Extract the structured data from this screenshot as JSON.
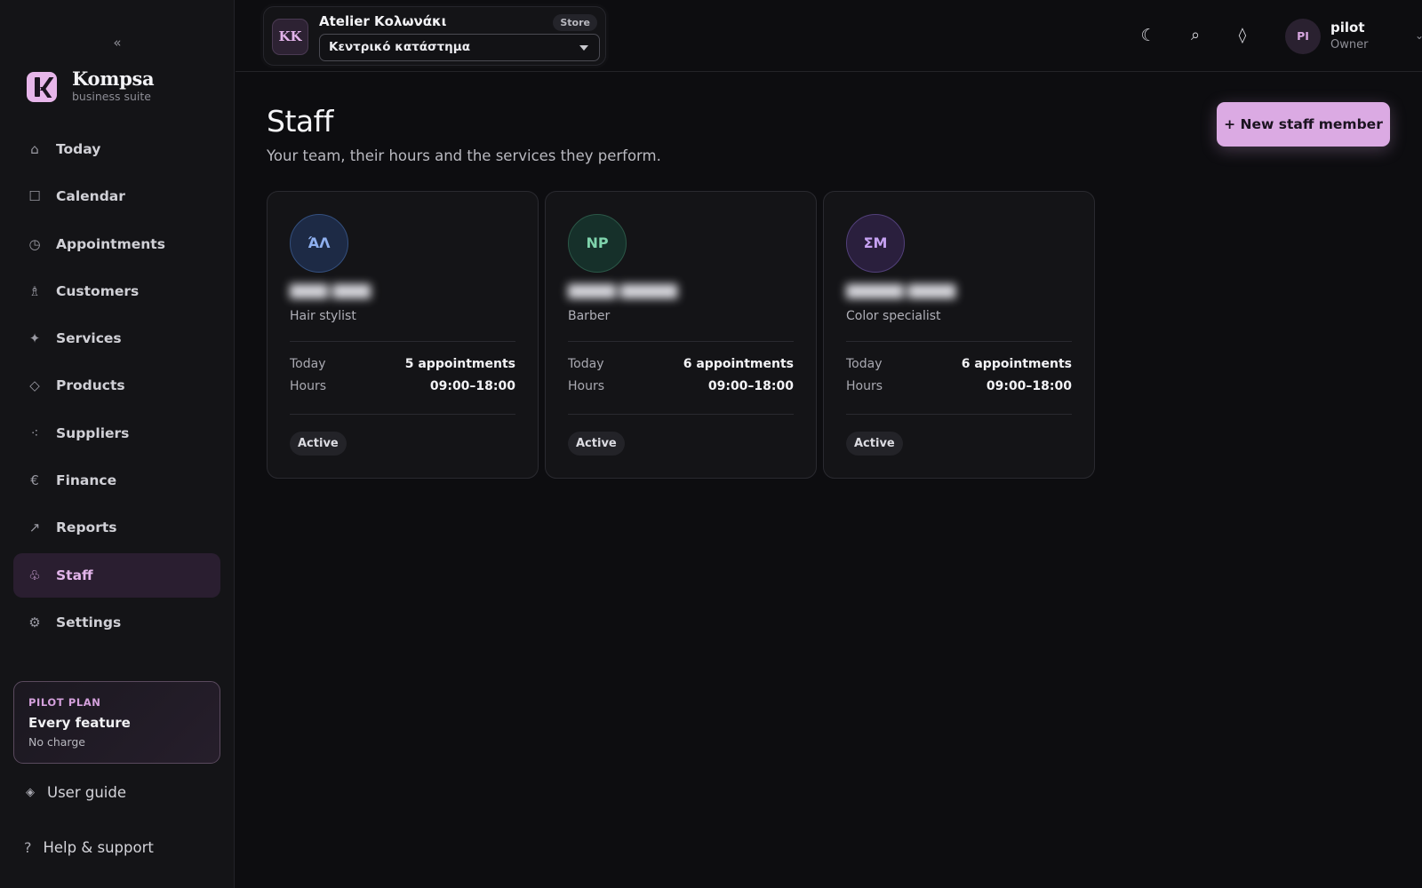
{
  "app": {
    "name": "Kompsa",
    "tagline": "business suite",
    "collapse_icon": "«"
  },
  "store": {
    "initials": "KK",
    "name": "Atelier Κολωνάκι",
    "badge": "Store",
    "branch": "Κεντρικό κατάστημα"
  },
  "nav": {
    "items": [
      {
        "label": "Today",
        "icon": "home-icon"
      },
      {
        "label": "Calendar",
        "icon": "calendar-icon"
      },
      {
        "label": "Appointments",
        "icon": "clock-icon"
      },
      {
        "label": "Customers",
        "icon": "person-icon"
      },
      {
        "label": "Services",
        "icon": "sparkle-icon"
      },
      {
        "label": "Products",
        "icon": "diamond-icon"
      },
      {
        "label": "Suppliers",
        "icon": "network-icon"
      },
      {
        "label": "Finance",
        "icon": "euro-icon"
      },
      {
        "label": "Reports",
        "icon": "arrow-up-right-icon"
      },
      {
        "label": "Staff",
        "icon": "staff-icon",
        "active": true
      },
      {
        "label": "Settings",
        "icon": "gear-icon"
      }
    ]
  },
  "plan": {
    "tag": "PILOT PLAN",
    "title": "Every feature",
    "subtitle": "No charge"
  },
  "footer": {
    "guide": "User guide",
    "help": "Help & support"
  },
  "user": {
    "initials": "PI",
    "name": "pilot",
    "role": "Owner"
  },
  "page": {
    "title": "Staff",
    "subtitle": "Your team, their hours and the services they perform.",
    "new_button": "+ New staff member"
  },
  "staff": [
    {
      "initials": "ΆΛ",
      "name": "████ ████",
      "role": "Hair stylist",
      "today_label": "Today",
      "today_value": "5 appointments",
      "hours_label": "Hours",
      "hours_value": "09:00–18:00",
      "status": "Active",
      "avatar_color": "blue"
    },
    {
      "initials": "NP",
      "name": "█████ ██████",
      "role": "Barber",
      "today_label": "Today",
      "today_value": "6 appointments",
      "hours_label": "Hours",
      "hours_value": "09:00–18:00",
      "status": "Active",
      "avatar_color": "green"
    },
    {
      "initials": "ΣΜ",
      "name": "██████ █████",
      "role": "Color specialist",
      "today_label": "Today",
      "today_value": "6 appointments",
      "hours_label": "Hours",
      "hours_value": "09:00–18:00",
      "status": "Active",
      "avatar_color": "purple"
    }
  ],
  "colors": {
    "accent": "#dbaae3",
    "background": "#0d0d10",
    "sidebar": "#141417",
    "active_nav": "#2a1e30"
  }
}
